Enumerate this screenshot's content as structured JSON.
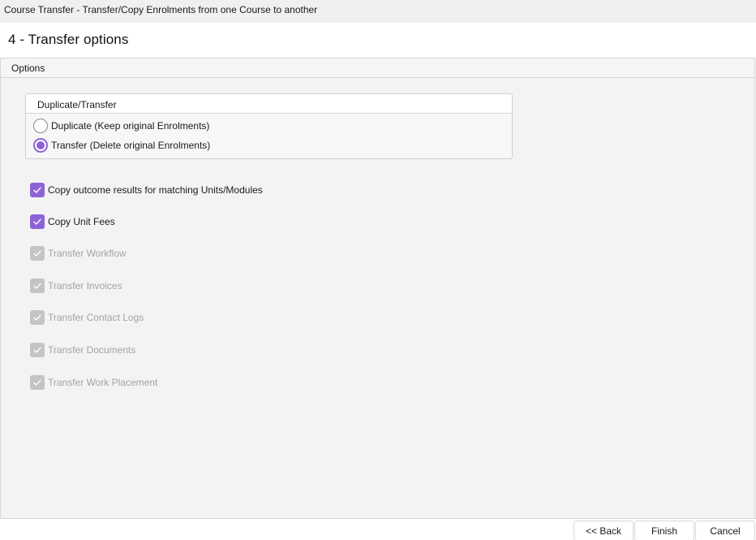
{
  "window": {
    "title": "Course Transfer  - Transfer/Copy Enrolments from one Course to another"
  },
  "header": {
    "title": "4 - Transfer options"
  },
  "options_tab": {
    "label": "Options"
  },
  "duplicate_transfer_group": {
    "title": "Duplicate/Transfer",
    "options": [
      {
        "label": "Duplicate (Keep original Enrolments)",
        "selected": false
      },
      {
        "label": "Transfer (Delete original Enrolments)",
        "selected": true
      }
    ]
  },
  "checkboxes": [
    {
      "label": "Copy outcome results for matching Units/Modules",
      "checked": true,
      "enabled": true
    },
    {
      "label": "Copy Unit Fees",
      "checked": true,
      "enabled": true
    },
    {
      "label": "Transfer Workflow",
      "checked": true,
      "enabled": false
    },
    {
      "label": "Transfer Invoices",
      "checked": true,
      "enabled": false
    },
    {
      "label": "Transfer Contact Logs",
      "checked": true,
      "enabled": false
    },
    {
      "label": "Transfer Documents",
      "checked": true,
      "enabled": false
    },
    {
      "label": "Transfer Work Placement",
      "checked": true,
      "enabled": false
    }
  ],
  "footer": {
    "back_label": "<< Back",
    "finish_label": "Finish",
    "cancel_label": "Cancel"
  },
  "colors": {
    "accent": "#8c63d6",
    "disabled": "#c4c4c4"
  }
}
